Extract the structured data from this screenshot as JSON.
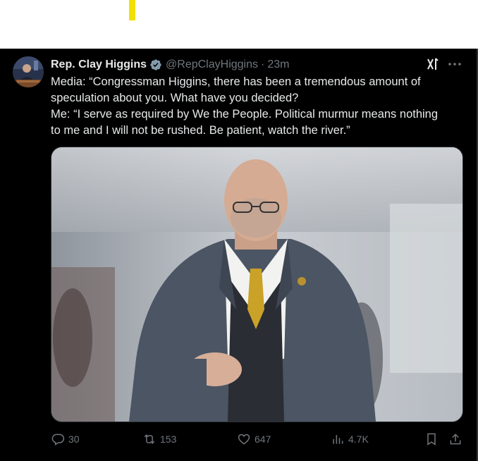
{
  "tweet": {
    "author": {
      "display_name": "Rep. Clay Higgins",
      "handle": "@RepClayHiggins",
      "verified": true,
      "avatar_icon": "avatar-photo"
    },
    "separator": "·",
    "timestamp": "23m",
    "text_lines": [
      "Media: “Congressman Higgins, there has been a tremendous amount of",
      "speculation about you. What have you decided?",
      "Me: “I serve as required by We the People. Political murmur means nothing",
      "to me and I will not be rushed. Be patient, watch the river.”"
    ],
    "media": {
      "type": "photo"
    },
    "actions": {
      "replies": "30",
      "reposts": "153",
      "likes": "647",
      "views": "4.7K"
    },
    "icons": {
      "grok": "grok-icon",
      "more": "more-icon",
      "reply": "reply-icon",
      "repost": "repost-icon",
      "like": "heart-icon",
      "views": "views-icon",
      "bookmark": "bookmark-icon",
      "share": "share-icon"
    }
  },
  "colors": {
    "background": "#000000",
    "text": "#e7e9ea",
    "muted": "#71767b",
    "verified": "#829aab",
    "highlight": "#f2e000"
  }
}
